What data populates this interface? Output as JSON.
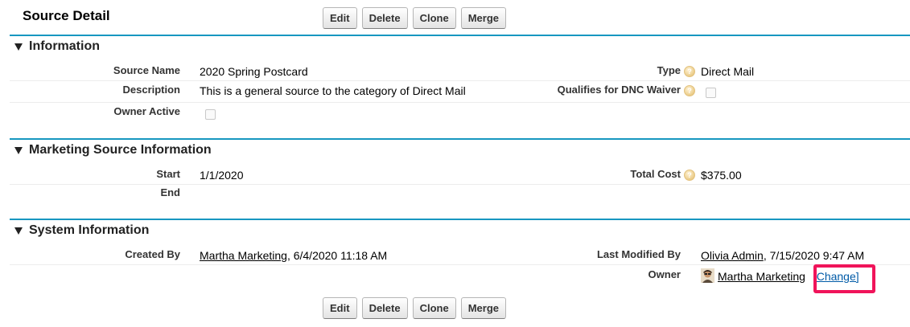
{
  "page": {
    "title": "Source Detail",
    "buttons": {
      "edit": "Edit",
      "delete": "Delete",
      "clone": "Clone",
      "merge": "Merge"
    }
  },
  "information": {
    "header": "Information",
    "source_name_label": "Source Name",
    "source_name": "2020 Spring Postcard",
    "type_label": "Type",
    "type": "Direct Mail",
    "description_label": "Description",
    "description": "This is a general source to the category of Direct Mail",
    "dnc_label": "Qualifies for DNC Waiver",
    "dnc_checked": false,
    "owner_active_label": "Owner Active",
    "owner_active_checked": false
  },
  "marketing": {
    "header": "Marketing Source Information",
    "start_label": "Start",
    "start": "1/1/2020",
    "end_label": "End",
    "end": "",
    "total_cost_label": "Total Cost",
    "total_cost": "$375.00"
  },
  "system": {
    "header": "System Information",
    "created_by_label": "Created By",
    "created_by_user": "Martha Marketing",
    "created_by_date": ", 6/4/2020 11:18 AM",
    "last_modified_label": "Last Modified By",
    "last_modified_user": "Olivia Admin",
    "last_modified_date": ", 7/15/2020 9:47 AM",
    "owner_label": "Owner",
    "owner": "Martha Marketing",
    "change_link": "[Change]"
  },
  "colors": {
    "section_bar": "#1797c0",
    "highlight": "#f0145a",
    "change_link": "#015ba7"
  }
}
